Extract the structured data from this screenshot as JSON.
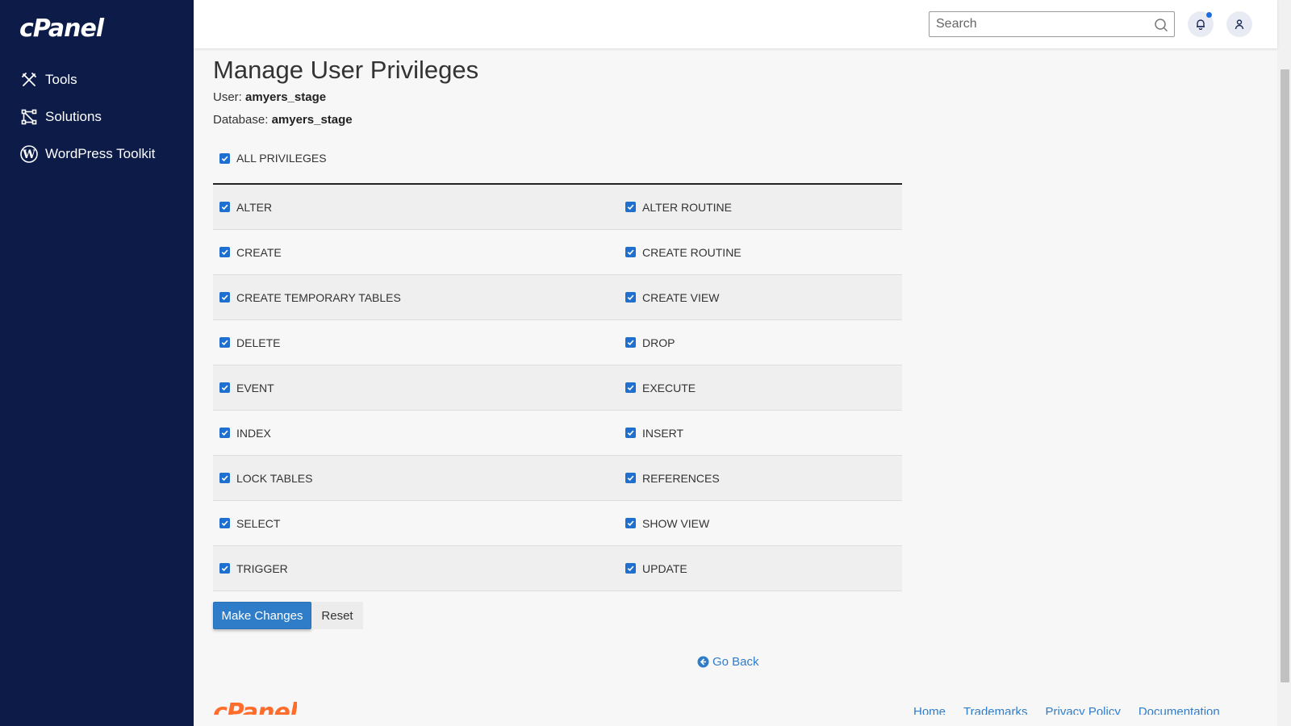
{
  "sidebar": {
    "logo": "cPanel",
    "items": [
      {
        "label": "Tools",
        "icon": "tools-icon"
      },
      {
        "label": "Solutions",
        "icon": "solutions-icon"
      },
      {
        "label": "WordPress Toolkit",
        "icon": "wordpress-icon"
      }
    ]
  },
  "header": {
    "search_placeholder": "Search",
    "notification_indicator": true
  },
  "page": {
    "title": "Manage User Privileges",
    "user_label": "User:",
    "user_value": "amyers_stage",
    "database_label": "Database:",
    "database_value": "amyers_stage"
  },
  "all_privileges": {
    "label": "ALL PRIVILEGES",
    "checked": true
  },
  "privileges": [
    {
      "left": "ALTER",
      "right": "ALTER ROUTINE"
    },
    {
      "left": "CREATE",
      "right": "CREATE ROUTINE"
    },
    {
      "left": "CREATE TEMPORARY TABLES",
      "right": "CREATE VIEW"
    },
    {
      "left": "DELETE",
      "right": "DROP"
    },
    {
      "left": "EVENT",
      "right": "EXECUTE"
    },
    {
      "left": "INDEX",
      "right": "INSERT"
    },
    {
      "left": "LOCK TABLES",
      "right": "REFERENCES"
    },
    {
      "left": "SELECT",
      "right": "SHOW VIEW"
    },
    {
      "left": "TRIGGER",
      "right": "UPDATE"
    }
  ],
  "actions": {
    "make_changes": "Make Changes",
    "reset": "Reset",
    "go_back": "Go Back"
  },
  "footer": {
    "logo": "cPanel",
    "links": [
      "Home",
      "Trademarks",
      "Privacy Policy",
      "Documentation"
    ]
  },
  "colors": {
    "sidebar_bg": "#0c1b48",
    "accent": "#2f7dc9",
    "checkbox": "#1f6fd0",
    "footer_logo": "#ff6c2c"
  }
}
